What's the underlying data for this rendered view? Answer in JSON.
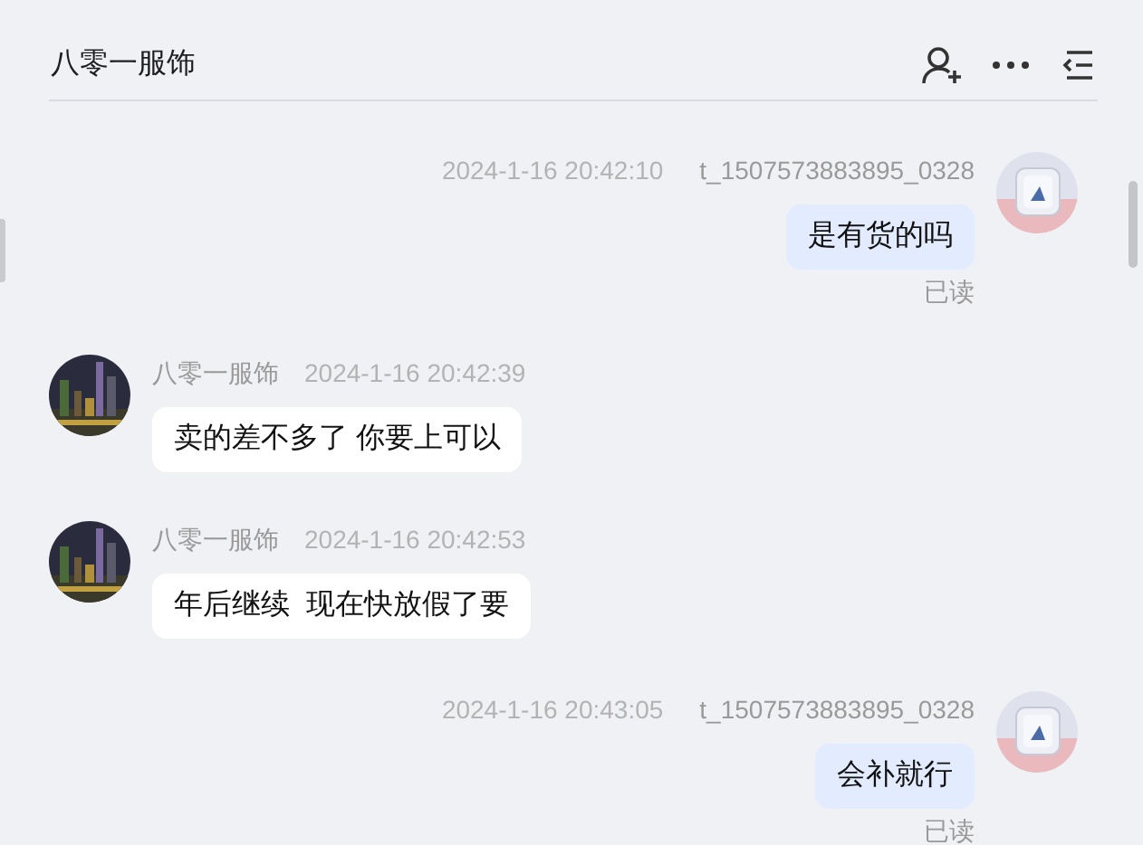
{
  "header": {
    "title": "八零一服饰"
  },
  "messages": [
    {
      "kind": "outgoing",
      "time": "2024-1-16 20:42:10",
      "sender": "t_1507573883895_0328",
      "text": "是有货的吗",
      "status": "已读"
    },
    {
      "kind": "incoming",
      "sender": "八零一服饰",
      "time": "2024-1-16 20:42:39",
      "text": "卖的差不多了 你要上可以"
    },
    {
      "kind": "incoming",
      "sender": "八零一服饰",
      "time": "2024-1-16 20:42:53",
      "text": "年后继续  现在快放假了要"
    },
    {
      "kind": "outgoing",
      "time": "2024-1-16 20:43:05",
      "sender": "t_1507573883895_0328",
      "text": "会补就行",
      "status": "已读"
    }
  ]
}
